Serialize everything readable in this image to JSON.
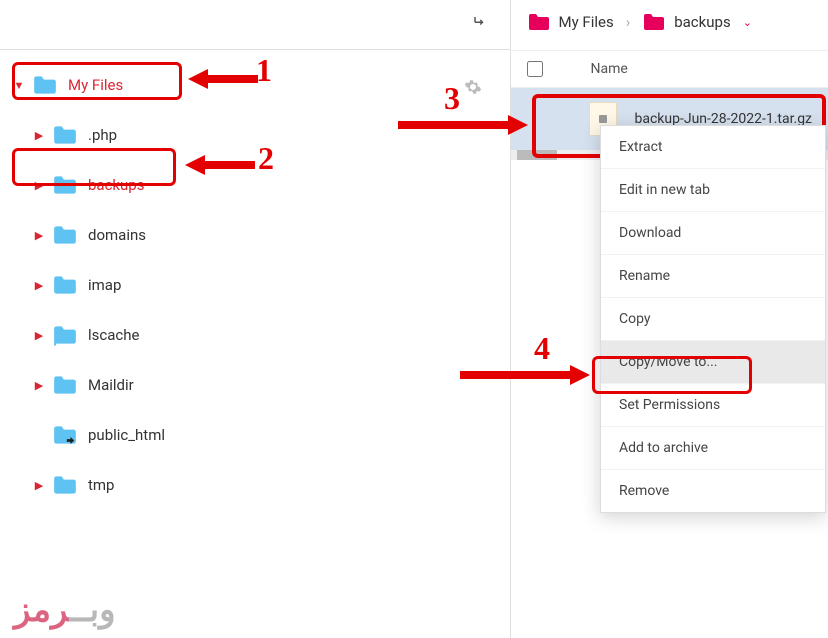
{
  "toolbar": {
    "goto_icon": "goto"
  },
  "tree": {
    "root": {
      "label": "My Files",
      "active": true
    },
    "items": [
      {
        "label": ".php"
      },
      {
        "label": "backups",
        "active": true
      },
      {
        "label": "domains"
      },
      {
        "label": "imap"
      },
      {
        "label": "lscache"
      },
      {
        "label": "Maildir"
      },
      {
        "label": "public_html",
        "linked": true
      },
      {
        "label": "tmp"
      }
    ]
  },
  "breadcrumb": {
    "root": "My Files",
    "current": "backups"
  },
  "file_header": {
    "name_col": "Name"
  },
  "file_row": {
    "filename": "backup-Jun-28-2022-1.tar.gz"
  },
  "context_menu": {
    "items": [
      "Extract",
      "Edit in new tab",
      "Download",
      "Rename",
      "Copy",
      "Copy/Move to...",
      "Set Permissions",
      "Add to archive",
      "Remove"
    ],
    "hover_index": 5
  },
  "annotations": {
    "n1": "1",
    "n2": "2",
    "n3": "3",
    "n4": "4"
  },
  "watermark": {
    "w1": "وبــ",
    "w2": "رمز"
  }
}
